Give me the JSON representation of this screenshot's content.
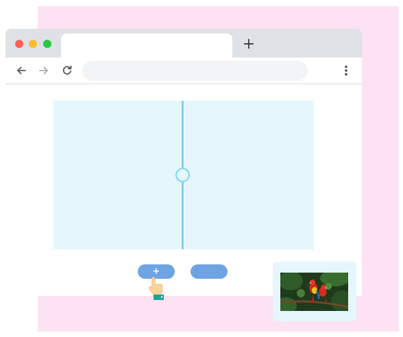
{
  "browser": {
    "new_tab_symbol": "+",
    "address_bar_value": "",
    "nav": {
      "back_icon": "arrow-left-icon",
      "forward_icon": "arrow-right-icon",
      "reload_icon": "reload-icon",
      "menu_icon": "kebab-menu-icon"
    }
  },
  "comparison_slider": {
    "divider_position_fraction": 0.5,
    "divider_color": "#7fd3ee",
    "background_color": "#e6f6fd"
  },
  "buttons": {
    "add_label": "+",
    "second_label": ""
  },
  "thumbnail": {
    "subject": "parrots-photo"
  },
  "colors": {
    "page_accent_pink": "#fde2f3",
    "button_blue": "#6ea4e3",
    "close_dot": "#ff5f57",
    "minimize_dot": "#febc2e",
    "maximize_dot": "#28c840"
  }
}
